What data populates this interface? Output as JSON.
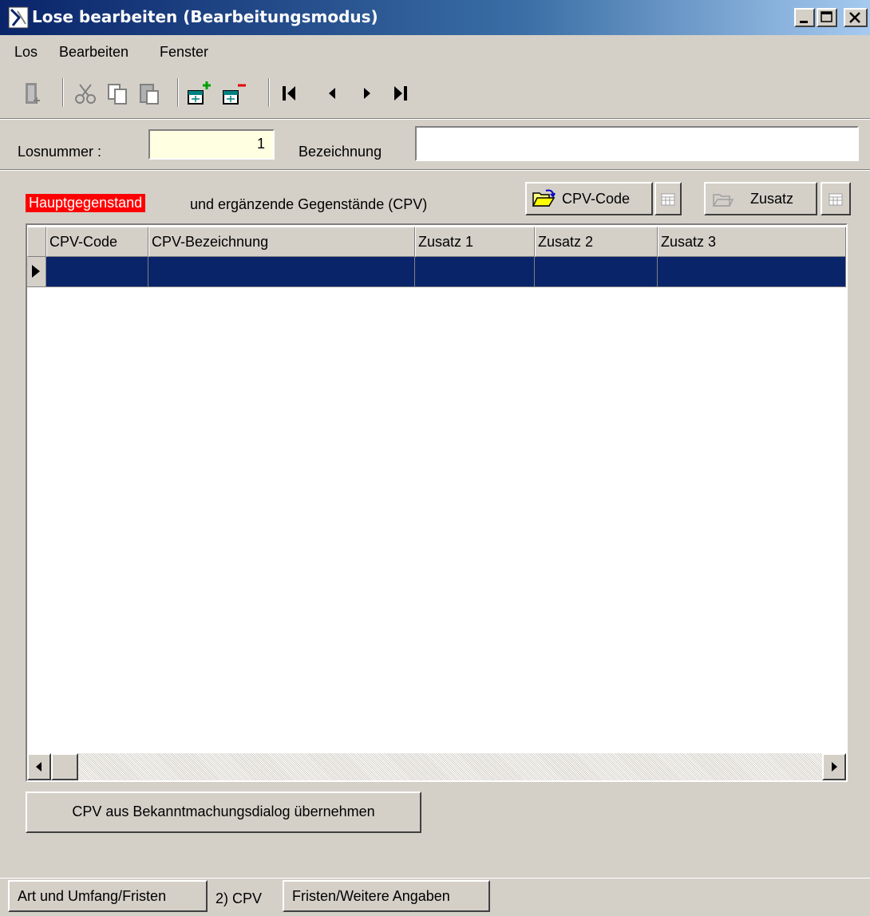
{
  "window": {
    "title": "Lose bearbeiten (Bearbeitungsmodus)",
    "controls": [
      "minimize",
      "maximize",
      "close"
    ]
  },
  "menubar": {
    "items": [
      "Los",
      "Bearbeiten",
      "Fenster"
    ]
  },
  "toolbar": {
    "icons": [
      "exit-icon",
      "cut-icon",
      "copy-icon",
      "paste-icon",
      "add-record-icon",
      "delete-record-icon",
      "first-record-icon",
      "previous-record-icon",
      "next-record-icon",
      "last-record-icon"
    ]
  },
  "form": {
    "losnummer_label": "Losnummer :",
    "losnummer_value": "1",
    "bezeichnung_label": "Bezeichnung",
    "bezeichnung_value": ""
  },
  "cpv": {
    "badge": "Hauptgegenstand",
    "caption": "und ergänzende Gegenstände (CPV)",
    "cpv_code_button": "CPV-Code",
    "zusatz_button": "Zusatz"
  },
  "grid": {
    "columns": [
      "CPV-Code",
      "CPV-Bezeichnung",
      "Zusatz 1",
      "Zusatz 2",
      "Zusatz 3"
    ],
    "rows": [
      [
        "",
        "",
        "",
        "",
        ""
      ]
    ]
  },
  "actions": {
    "uebernehmen_button": "CPV aus Bekanntmachungsdialog übernehmen"
  },
  "tabs": [
    "Art und Umfang/Fristen",
    "2) CPV",
    "Fristen/Weitere Angaben"
  ],
  "colors": {
    "title_start": "#0a246a",
    "title_end": "#a6caf0",
    "selection": "#0a246a",
    "badge_bg": "#ff0000",
    "face": "#d4d0c8"
  }
}
